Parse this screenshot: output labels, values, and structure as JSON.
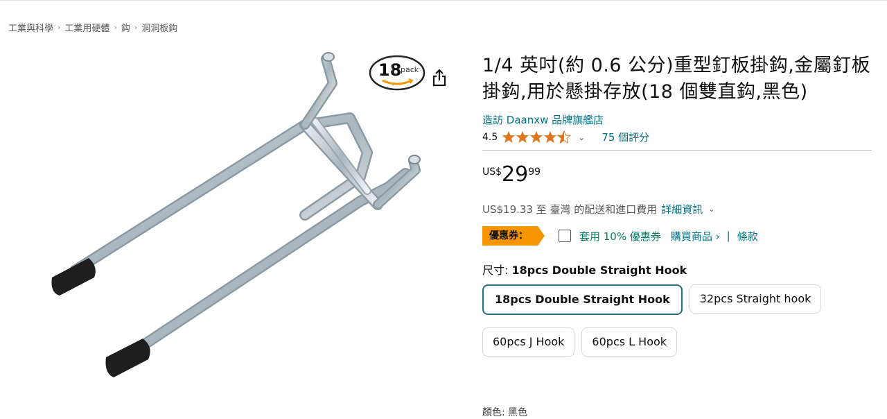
{
  "breadcrumb": [
    "工業與科學",
    "工業用硬體",
    "鈎",
    "洞洞板鈎"
  ],
  "pack_badge": {
    "number": "18",
    "text": "pack"
  },
  "product": {
    "title": "1/4 英吋(約 0.6 公分)重型釘板掛鈎,金屬釘板掛鈎,用於懸掛存放(18 個雙直鈎,黑色)",
    "store": "造訪 Daanxw 品牌旗艦店",
    "rating_value": "4.5",
    "rating_stars": 4.5,
    "reviews": "75 個評分",
    "price_currency": "US$",
    "price_whole": "29",
    "price_fraction": "99",
    "shipping_text": "US$19.33 至 臺灣 的配送和進口費用",
    "shipping_link": "詳細資訊",
    "coupon_badge": "優惠券：",
    "coupon_text": "套用 10% 優惠券",
    "coupon_link": "購買商品 ›",
    "coupon_sep": "|",
    "terms_link": "條款",
    "size_label": "尺寸:",
    "size_selected": "18pcs Double Straight Hook",
    "options": [
      "18pcs Double Straight Hook",
      "32pcs Straight hook",
      "60pcs J Hook",
      "60pcs L Hook"
    ],
    "next_label_partial": "顏色: 黑色"
  },
  "colors": {
    "link": "#007185",
    "coupon": "#f79400",
    "star": "#de7921",
    "selected_border": "#2b6f7f"
  }
}
